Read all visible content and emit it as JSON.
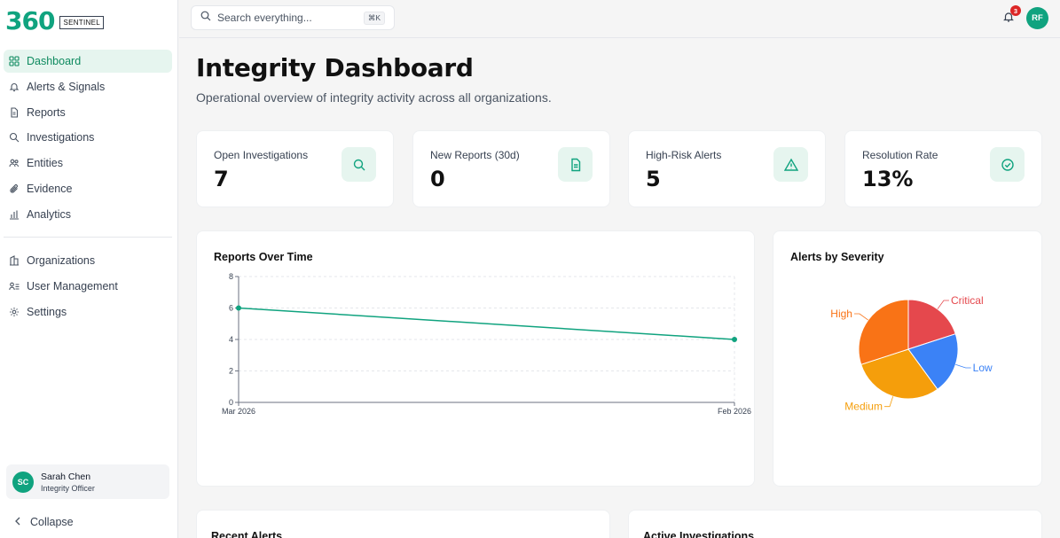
{
  "brand": {
    "logo_text": "360",
    "badge": "SENTINEL"
  },
  "sidebar": {
    "items": [
      {
        "label": "Dashboard",
        "icon": "grid-icon",
        "active": true
      },
      {
        "label": "Alerts & Signals",
        "icon": "bell-icon"
      },
      {
        "label": "Reports",
        "icon": "document-icon"
      },
      {
        "label": "Investigations",
        "icon": "search-icon"
      },
      {
        "label": "Entities",
        "icon": "users-icon"
      },
      {
        "label": "Evidence",
        "icon": "paperclip-icon"
      },
      {
        "label": "Analytics",
        "icon": "bar-chart-icon"
      }
    ],
    "admin_items": [
      {
        "label": "Organizations",
        "icon": "building-icon"
      },
      {
        "label": "User Management",
        "icon": "user-list-icon"
      },
      {
        "label": "Settings",
        "icon": "gear-icon"
      }
    ],
    "user": {
      "initials": "SC",
      "name": "Sarah Chen",
      "role": "Integrity Officer"
    },
    "collapse_label": "Collapse"
  },
  "topbar": {
    "search_placeholder": "Search everything...",
    "shortcut": "⌘K",
    "notification_count": "3",
    "user_initials": "RF"
  },
  "page": {
    "title": "Integrity Dashboard",
    "subtitle": "Operational overview of integrity activity across all organizations."
  },
  "stats": [
    {
      "label": "Open Investigations",
      "value": "7",
      "icon": "search-icon"
    },
    {
      "label": "New Reports (30d)",
      "value": "0",
      "icon": "document-icon"
    },
    {
      "label": "High-Risk Alerts",
      "value": "5",
      "icon": "warning-icon"
    },
    {
      "label": "Resolution Rate",
      "value": "13%",
      "icon": "check-circle-icon"
    }
  ],
  "panels": {
    "reports_title": "Reports Over Time",
    "severity_title": "Alerts by Severity",
    "recent_alerts_title": "Recent Alerts",
    "active_investigations_title": "Active Investigations"
  },
  "colors": {
    "accent": "#10a37f",
    "critical": "#e5484d",
    "high": "#f97316",
    "medium": "#f59e0b",
    "low": "#3b82f6"
  },
  "chart_data": [
    {
      "type": "line",
      "title": "Reports Over Time",
      "categories": [
        "Mar 2026",
        "Feb 2026"
      ],
      "series": [
        {
          "values": [
            6,
            4
          ]
        }
      ],
      "ylim": [
        0,
        8
      ],
      "yticks": [
        0,
        2,
        4,
        6,
        8
      ],
      "grid": true
    },
    {
      "type": "pie",
      "title": "Alerts by Severity",
      "labels": [
        "Critical",
        "Low",
        "Medium",
        "High"
      ],
      "values": [
        1,
        1,
        1.5,
        1.5
      ],
      "colors": [
        "#e5484d",
        "#3b82f6",
        "#f59e0b",
        "#f97316"
      ]
    }
  ]
}
